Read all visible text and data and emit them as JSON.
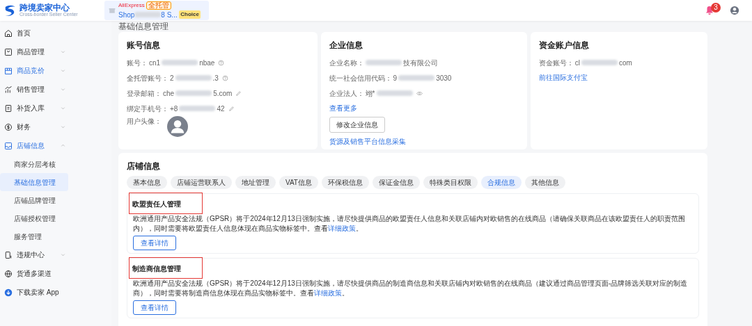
{
  "header": {
    "logo_title": "跨境卖家中心",
    "logo_subtitle": "Cross-border Seller Center",
    "shop": {
      "platform": "AliExpress",
      "tag": "全托管",
      "name_start": "Shop",
      "name_end": "8 S...",
      "program": "Choice"
    },
    "notification_count": "3"
  },
  "sidebar": {
    "items": [
      {
        "label": "首页",
        "chevron": false,
        "highlighted": false,
        "expanded": false
      },
      {
        "label": "商品管理",
        "chevron": true,
        "highlighted": false,
        "expanded": false
      },
      {
        "label": "商品竞价",
        "chevron": true,
        "highlighted": true,
        "expanded": false
      },
      {
        "label": "销售管理",
        "chevron": true,
        "highlighted": false,
        "expanded": false
      },
      {
        "label": "补货入库",
        "chevron": true,
        "highlighted": false,
        "expanded": false
      },
      {
        "label": "财务",
        "chevron": true,
        "highlighted": false,
        "expanded": false
      },
      {
        "label": "店铺信息",
        "chevron": true,
        "highlighted": true,
        "expanded": true,
        "children": [
          {
            "label": "商家分层考核",
            "selected": false
          },
          {
            "label": "基础信息管理",
            "selected": true
          },
          {
            "label": "店铺品牌管理",
            "selected": false
          },
          {
            "label": "店铺授权管理",
            "selected": false
          },
          {
            "label": "服务管理",
            "selected": false
          }
        ]
      },
      {
        "label": "违规中心",
        "chevron": true,
        "highlighted": false,
        "expanded": false
      },
      {
        "label": "货通多渠道",
        "chevron": false,
        "highlighted": false,
        "expanded": false
      },
      {
        "label": "下载卖家 App",
        "chevron": false,
        "highlighted": false,
        "expanded": false
      }
    ]
  },
  "page_title": "基础信息管理",
  "cards": [
    {
      "title": "账号信息",
      "fields": [
        {
          "label": "账号：",
          "prefix": "cn1",
          "suffix": "nbae"
        },
        {
          "label": "全托管账号：",
          "prefix": "2",
          "suffix": ".3"
        },
        {
          "label": "登录邮箱：",
          "prefix": "che",
          "suffix": "5.com"
        },
        {
          "label": "绑定手机号：",
          "prefix": "+8",
          "suffix": "42"
        },
        {
          "label": "用户头像：",
          "kind": "avatar"
        }
      ]
    },
    {
      "title": "企业信息",
      "fields": [
        {
          "label": "企业名称：",
          "suffix": "技有限公司"
        },
        {
          "label": "统一社会信用代码：",
          "prefix": "9",
          "suffix": "3030"
        },
        {
          "label": "企业法人：",
          "prefix": "翊*"
        }
      ],
      "link": "查看更多",
      "button": "修改企业信息",
      "link2": "货源及销售平台信息采集"
    },
    {
      "title": "资金账户信息",
      "fields": [
        {
          "label": "资金账号：",
          "prefix": "cl",
          "suffix": "com"
        }
      ],
      "link": "前往国际支付宝"
    }
  ],
  "store": {
    "title": "店铺信息",
    "tabs": [
      {
        "label": "基本信息",
        "selected": false
      },
      {
        "label": "店铺运营联系人",
        "selected": false
      },
      {
        "label": "地址管理",
        "selected": false
      },
      {
        "label": "VAT信息",
        "selected": false
      },
      {
        "label": "环保税信息",
        "selected": false
      },
      {
        "label": "保证金信息",
        "selected": false
      },
      {
        "label": "特殊类目权限",
        "selected": false
      },
      {
        "label": "合规信息",
        "selected": true
      },
      {
        "label": "其他信息",
        "selected": false
      }
    ],
    "sections": [
      {
        "title": "欧盟责任人管理",
        "annotated": true,
        "text": "欧洲通用产品安全法规（GPSR）将于2024年12月13日强制实施，请尽快提供商品的欧盟责任人信息和关联店铺内对欧销售的在线商品（请确保关联商品在该欧盟责任人的职责范围内），同时需要将欧盟责任人信息体现在商品实物标签中。查看",
        "link": "详细政策",
        "end": "。",
        "button": "查看详情"
      },
      {
        "title": "制造商信息管理",
        "annotated": true,
        "text": "欧洲通用产品安全法规（GPSR）将于2024年12月13日强制实施，请尽快提供商品的制造商信息和关联店铺内对欧销售的在线商品（建议通过商品管理页面-品牌筛选关联对应的制造商），同时需要将制造商信息体现在商品实物标签中。查看",
        "link": "详细政策",
        "end": "。",
        "button": "查看详情"
      }
    ]
  }
}
